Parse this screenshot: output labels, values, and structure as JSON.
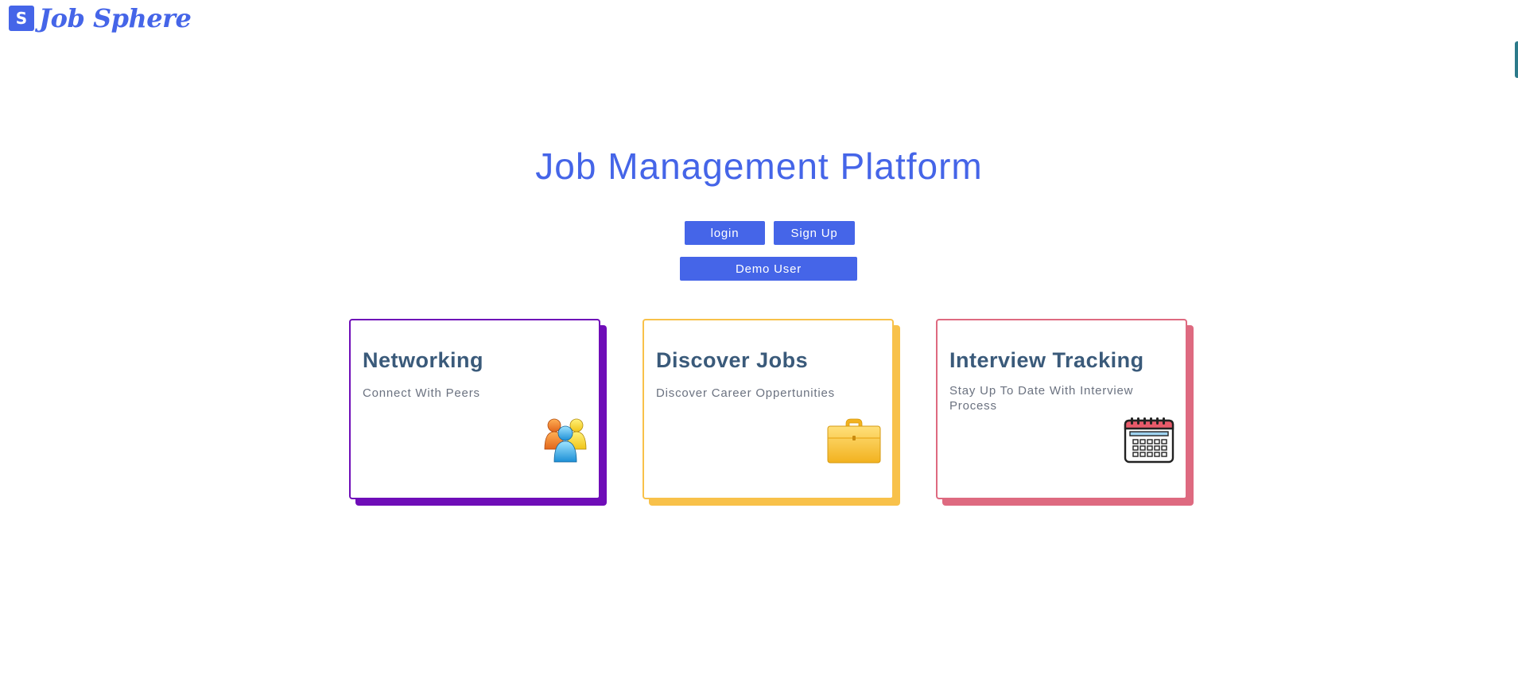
{
  "header": {
    "logo_letter": "S",
    "brand_name": "Job Sphere"
  },
  "main": {
    "title": "Job Management Platform",
    "buttons": {
      "login": "login",
      "signup": "Sign Up",
      "demo": "Demo User"
    }
  },
  "cards": [
    {
      "title": "Networking",
      "description": "Connect With Peers",
      "icon": "people-group-icon",
      "accent": "#6f0db8"
    },
    {
      "title": "Discover Jobs",
      "description": "Discover Career Oppertunities",
      "icon": "briefcase-icon",
      "accent": "#f8c14a"
    },
    {
      "title": "Interview Tracking",
      "description": "Stay Up To Date With Interview Process",
      "icon": "calendar-icon",
      "accent": "#de6a80"
    }
  ],
  "colors": {
    "brand": "#4565e8",
    "card_title": "#3a5a7a",
    "card_text": "#6b7280"
  }
}
